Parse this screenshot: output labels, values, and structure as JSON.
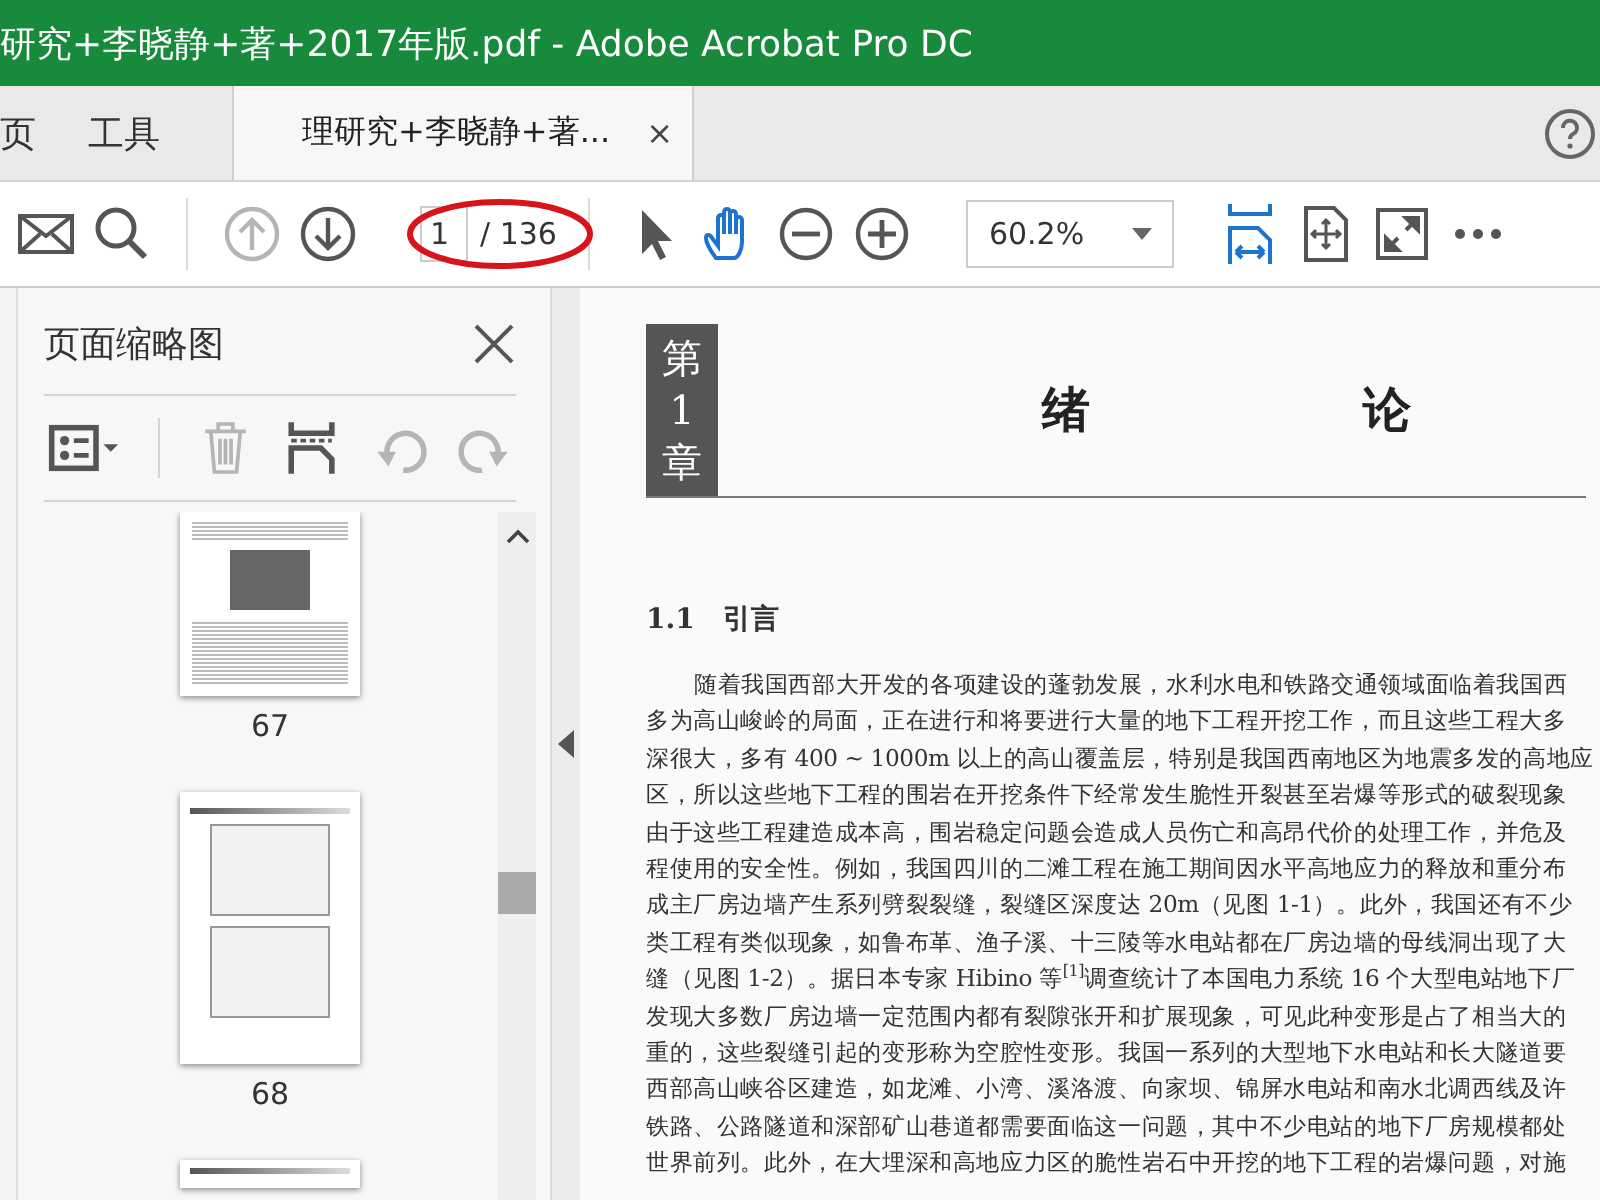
{
  "window": {
    "title": "研究+李晓静+著+2017年版.pdf - Adobe Acrobat Pro DC"
  },
  "tabs": [
    {
      "label": "页",
      "selected": false
    },
    {
      "label": "工具",
      "selected": false
    },
    {
      "label": "理研究+李晓静+著...",
      "selected": true,
      "close": "×"
    }
  ],
  "toolbar": [
    {
      "kind": "mail",
      "disabled": false
    },
    {
      "kind": "search",
      "disabled": false
    },
    {
      "kind": "sep"
    },
    {
      "kind": "prev",
      "disabled": true
    },
    {
      "kind": "next",
      "disabled": false
    },
    {
      "kind": "page"
    },
    {
      "kind": "sep"
    },
    {
      "kind": "select",
      "disabled": false
    },
    {
      "kind": "hand",
      "disabled": false
    },
    {
      "kind": "zoomout",
      "disabled": false
    },
    {
      "kind": "zoomin",
      "disabled": false
    },
    {
      "kind": "zoom"
    },
    {
      "kind": "fitwidth",
      "disabled": false
    },
    {
      "kind": "fitpage",
      "disabled": false
    },
    {
      "kind": "fullscreen",
      "disabled": false
    },
    {
      "kind": "more",
      "disabled": false
    }
  ],
  "page_field": {
    "value": "1",
    "total": "/ 136",
    "circled": true
  },
  "zoom": {
    "value": "60.2%"
  },
  "sidebar": {
    "title": "页面缩略图",
    "tools": [
      {
        "kind": "options",
        "disabled": false
      },
      {
        "kind": "sep"
      },
      {
        "kind": "trash",
        "disabled": true
      },
      {
        "kind": "extract",
        "disabled": false
      },
      {
        "kind": "rotateleft",
        "disabled": true
      },
      {
        "kind": "rotateright",
        "disabled": true
      }
    ],
    "thumbnails": [
      {
        "label": "67",
        "kind": "photo",
        "selected": false
      },
      {
        "label": "68",
        "kind": "charts",
        "selected": false
      },
      {
        "kind": "partial",
        "selected": false
      }
    ]
  },
  "document": {
    "chapter": [
      "第",
      "1",
      "章"
    ],
    "title": "绪 论",
    "heading": "1.1　引言",
    "lines": [
      "随着我国西部大开发的各项建设的蓬勃发展，水利水电和铁路交通领域面临着我国西",
      "多为高山峻岭的局面，正在进行和将要进行大量的地下工程开挖工作，而且这些工程大多",
      "深很大，多有 400 ~ 1000m 以上的高山覆盖层，特别是我国西南地区为地震多发的高地应",
      "区，所以这些地下工程的围岩在开挖条件下经常发生脆性开裂甚至岩爆等形式的破裂现象",
      "由于这些工程建造成本高，围岩稳定问题会造成人员伤亡和高昂代价的处理工作，并危及",
      "程使用的安全性。例如，我国四川的二滩工程在施工期间因水平高地应力的释放和重分布",
      "成主厂房边墙产生系列劈裂裂缝，裂缝区深度达 20m（见图 1-1）。此外，我国还有不少",
      "类工程有类似现象，如鲁布革、渔子溪、十三陵等水电站都在厂房边墙的母线洞出现了大",
      "缝（见图 1-2）。据日本专家 Hibino 等$^{[1]}$调查统计了本国电力系统 16 个大型电站地下厂",
      "发现大多数厂房边墙一定范围内都有裂隙张开和扩展现象，可见此种变形是占了相当大的",
      "重的，这些裂缝引起的变形称为空腔性变形。我国一系列的大型地下水电站和长大隧道要",
      "西部高山峡谷区建造，如龙滩、小湾、溪洛渡、向家坝、锦屏水电站和南水北调西线及许",
      "铁路、公路隧道和深部矿山巷道都需要面临这一问题，其中不少电站的地下厂房规模都处",
      "世界前列。此外，在大埋深和高地应力区的脆性岩石中开挖的地下工程的岩爆问题，对施"
    ]
  }
}
